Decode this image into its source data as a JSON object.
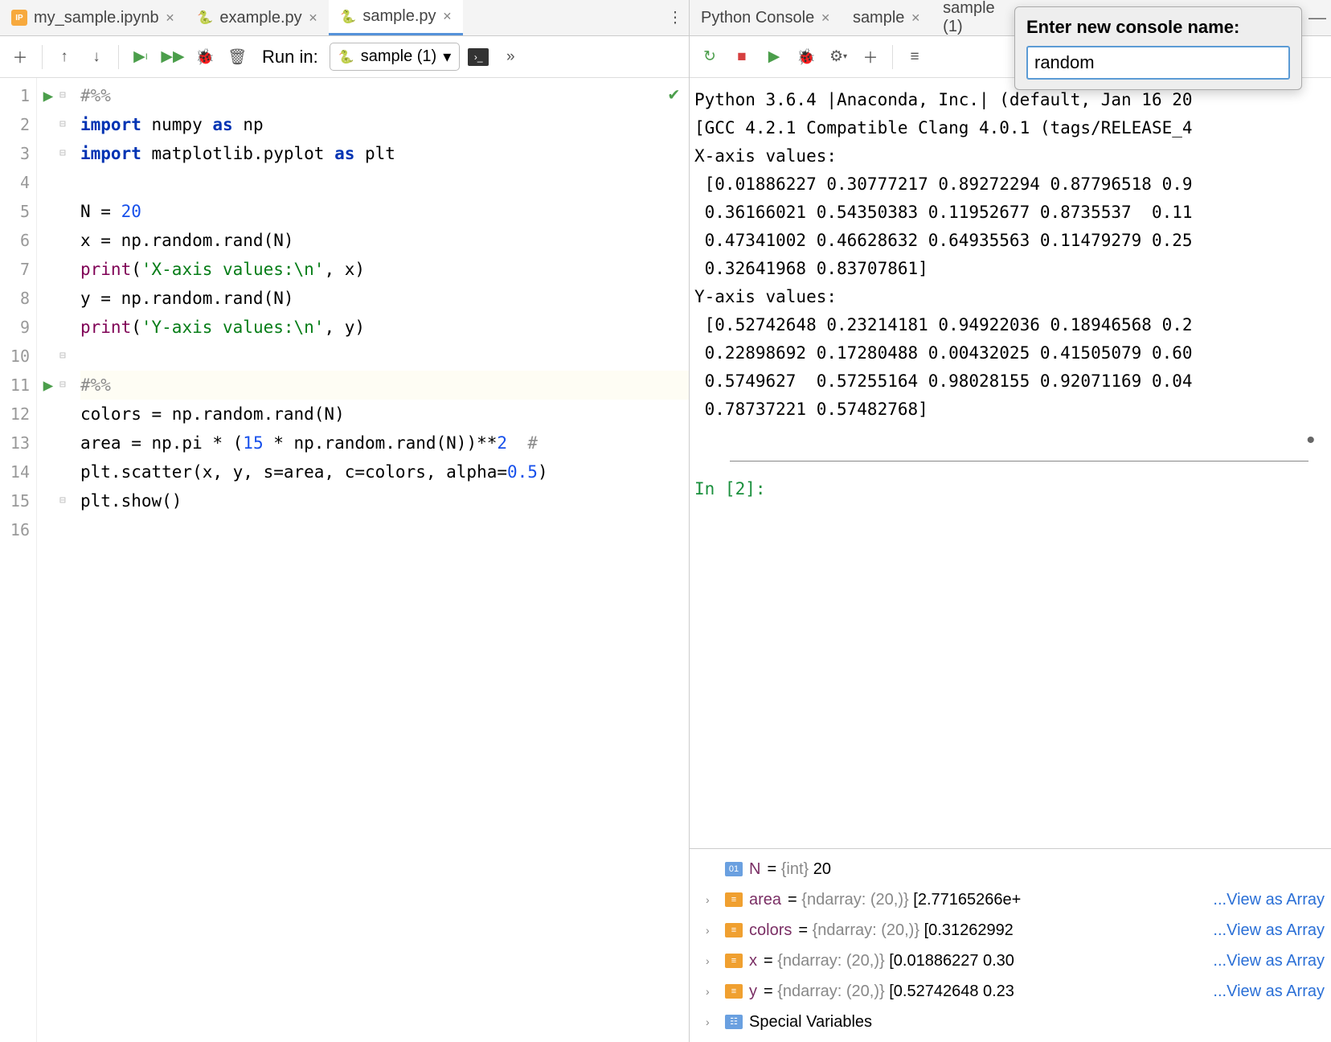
{
  "editorTabs": [
    {
      "label": "my_sample.ipynb",
      "icon": "ipy",
      "active": false
    },
    {
      "label": "example.py",
      "icon": "py",
      "active": false
    },
    {
      "label": "sample.py",
      "icon": "py",
      "active": true
    }
  ],
  "runIn": {
    "label": "Run in:",
    "value": "sample (1)"
  },
  "code": {
    "lines": [
      {
        "n": 1,
        "mark": "play",
        "cell": false,
        "html": "#%%",
        "cls": "cmt"
      },
      {
        "n": 2,
        "html_raw": "<span class='kw'>import</span> numpy <span class='kw'>as</span> np"
      },
      {
        "n": 3,
        "html_raw": "<span class='kw'>import</span> matplotlib.pyplot <span class='kw'>as</span> plt"
      },
      {
        "n": 4,
        "html_raw": ""
      },
      {
        "n": 5,
        "html_raw": "N = <span class='num'>20</span>"
      },
      {
        "n": 6,
        "html_raw": "x = np.random.rand(N)"
      },
      {
        "n": 7,
        "html_raw": "<span class='builtin'>print</span>(<span class='str'>'X-axis values:\\n'</span>, x)"
      },
      {
        "n": 8,
        "html_raw": "y = np.random.rand(N)"
      },
      {
        "n": 9,
        "html_raw": "<span class='builtin'>print</span>(<span class='str'>'Y-axis values:\\n'</span>, y)"
      },
      {
        "n": 10,
        "html_raw": ""
      },
      {
        "n": 11,
        "mark": "play",
        "cell": true,
        "html": "#%%",
        "cls": "cmt"
      },
      {
        "n": 12,
        "html_raw": "colors = np.random.rand(N)"
      },
      {
        "n": 13,
        "html_raw": "area = np.pi * (<span class='num'>15</span> * np.random.rand(N))**<span class='num'>2</span>  <span class='cmt'>#"
      },
      {
        "n": 14,
        "html_raw": "plt.scatter(x, y, s=area, c=colors, alpha=<span class='num'>0.5</span>)"
      },
      {
        "n": 15,
        "html_raw": "plt.show()"
      },
      {
        "n": 16,
        "html_raw": ""
      }
    ]
  },
  "consoleTabs": [
    {
      "label": "Python Console",
      "active": true,
      "close": true
    },
    {
      "label": "sample",
      "active": false,
      "close": true
    },
    {
      "label": "sample (1)",
      "active": false,
      "close": true
    }
  ],
  "renamePopup": {
    "label": "Enter new console name:",
    "value": "random"
  },
  "consoleOutput": [
    "Python 3.6.4 |Anaconda, Inc.| (default, Jan 16 20",
    "[GCC 4.2.1 Compatible Clang 4.0.1 (tags/RELEASE_4",
    "X-axis values:",
    " [0.01886227 0.30777217 0.89272294 0.87796518 0.9",
    " 0.36166021 0.54350383 0.11952677 0.8735537  0.11",
    " 0.47341002 0.46628632 0.64935563 0.11479279 0.25",
    " 0.32641968 0.83707861]",
    "Y-axis values:",
    " [0.52742648 0.23214181 0.94922036 0.18946568 0.2",
    " 0.22898692 0.17280488 0.00432025 0.41505079 0.60",
    " 0.5749627  0.57255164 0.98028155 0.92071169 0.04",
    " 0.78737221 0.57482768]"
  ],
  "prompt": "In [2]:",
  "vars": [
    {
      "arrow": "",
      "icon": "int",
      "iconTxt": "01",
      "name": "N",
      "rest": " = {int} 20",
      "link": ""
    },
    {
      "arrow": "›",
      "icon": "arr",
      "iconTxt": "≡",
      "name": "area",
      "rest": " = {ndarray: (20,)} [2.77165266e+",
      "link": "...View as Array"
    },
    {
      "arrow": "›",
      "icon": "arr",
      "iconTxt": "≡",
      "name": "colors",
      "rest": " = {ndarray: (20,)} [0.31262992 ",
      "link": "...View as Array"
    },
    {
      "arrow": "›",
      "icon": "arr",
      "iconTxt": "≡",
      "name": "x",
      "rest": " = {ndarray: (20,)} [0.01886227 0.30",
      "link": "...View as Array"
    },
    {
      "arrow": "›",
      "icon": "arr",
      "iconTxt": "≡",
      "name": "y",
      "rest": " = {ndarray: (20,)} [0.52742648 0.23",
      "link": "...View as Array"
    },
    {
      "arrow": "›",
      "icon": "sp",
      "iconTxt": "☷",
      "name": "",
      "rest": "Special Variables",
      "link": ""
    }
  ]
}
